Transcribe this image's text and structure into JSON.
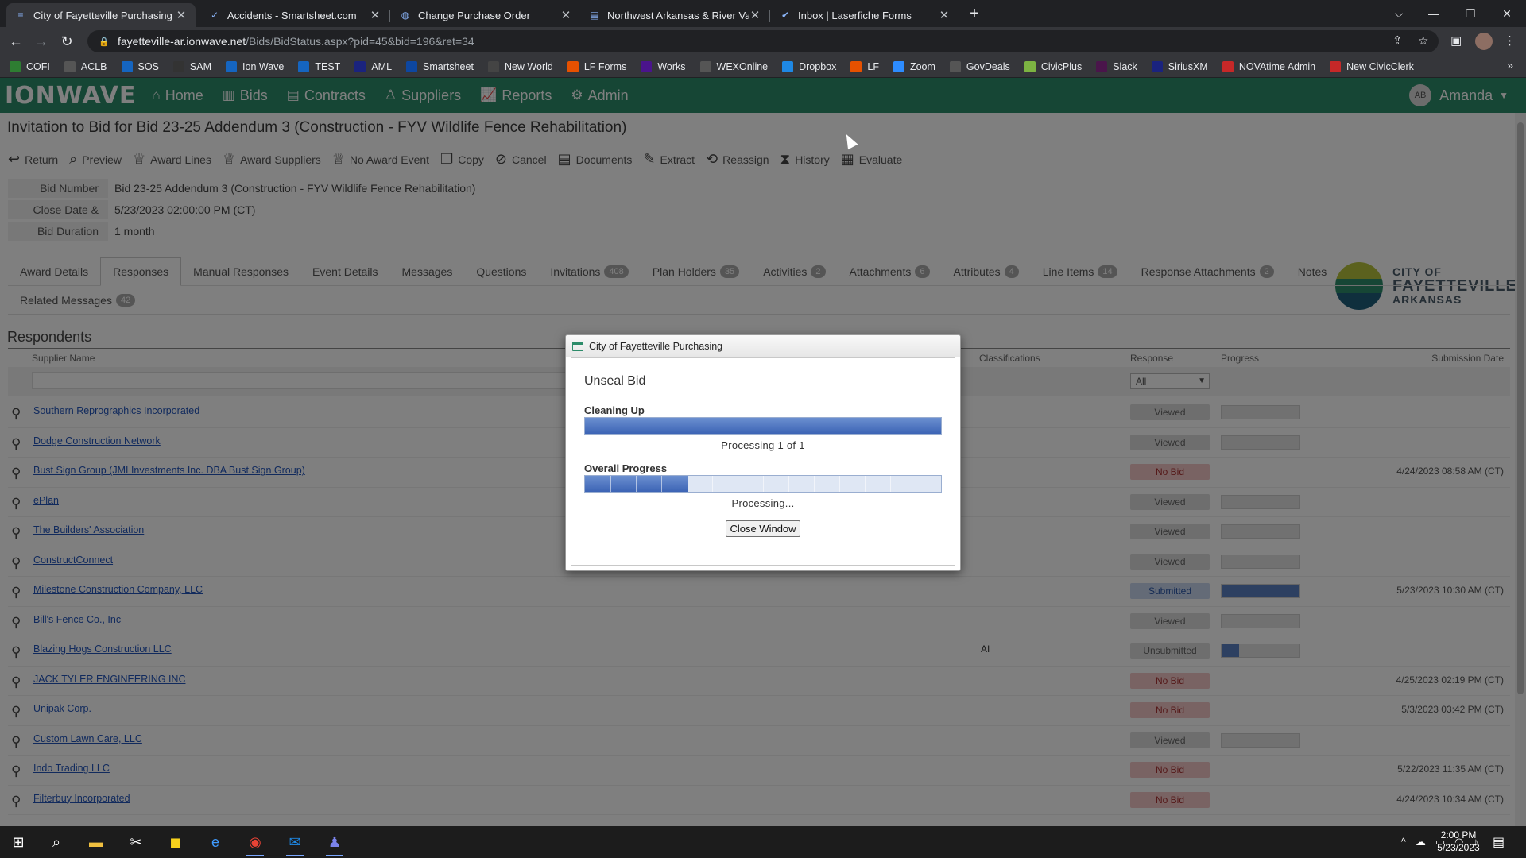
{
  "browser": {
    "tabs": [
      {
        "title": "City of Fayetteville Purchasing",
        "icon": "ionwave-icon",
        "active": true
      },
      {
        "title": "Accidents - Smartsheet.com",
        "icon": "smartsheet-icon",
        "active": false
      },
      {
        "title": "Change Purchase Order",
        "icon": "globe-icon",
        "active": false
      },
      {
        "title": "Northwest Arkansas & River Vall",
        "icon": "doc-icon",
        "active": false
      },
      {
        "title": "Inbox | Laserfiche Forms",
        "icon": "laserfiche-icon",
        "active": false
      }
    ],
    "url_host": "fayetteville-ar.ionwave.net",
    "url_path": "/Bids/BidStatus.aspx?pid=45&bid=196&ret=34",
    "bookmarks": [
      {
        "label": "COFI",
        "color": "#2e7d32"
      },
      {
        "label": "ACLB",
        "color": "#555555"
      },
      {
        "label": "SOS",
        "color": "#1565c0"
      },
      {
        "label": "SAM",
        "color": "#333333"
      },
      {
        "label": "Ion Wave",
        "color": "#1565c0"
      },
      {
        "label": "TEST",
        "color": "#1565c0"
      },
      {
        "label": "AML",
        "color": "#1a237e"
      },
      {
        "label": "Smartsheet",
        "color": "#0d47a1"
      },
      {
        "label": "New World",
        "color": "#444444"
      },
      {
        "label": "LF Forms",
        "color": "#e65100"
      },
      {
        "label": "Works",
        "color": "#4a148c"
      },
      {
        "label": "WEXOnline",
        "color": "#555555"
      },
      {
        "label": "Dropbox",
        "color": "#1e88e5"
      },
      {
        "label": "LF",
        "color": "#e65100"
      },
      {
        "label": "Zoom",
        "color": "#2d8cff"
      },
      {
        "label": "GovDeals",
        "color": "#555555"
      },
      {
        "label": "CivicPlus",
        "color": "#7cb342"
      },
      {
        "label": "Slack",
        "color": "#4a154b"
      },
      {
        "label": "SiriusXM",
        "color": "#1a237e"
      },
      {
        "label": "NOVAtime Admin",
        "color": "#c62828"
      },
      {
        "label": "New CivicClerk",
        "color": "#c62828"
      }
    ]
  },
  "app": {
    "logo": "IONWAVE",
    "nav": [
      {
        "label": "Home",
        "icon": "home-icon"
      },
      {
        "label": "Bids",
        "icon": "bids-icon"
      },
      {
        "label": "Contracts",
        "icon": "contracts-icon"
      },
      {
        "label": "Suppliers",
        "icon": "suppliers-icon"
      },
      {
        "label": "Reports",
        "icon": "reports-icon"
      },
      {
        "label": "Admin",
        "icon": "gear-icon"
      }
    ],
    "user_initials": "AB",
    "user_name": "Amanda",
    "page_title": "Invitation to Bid for Bid 23-25 Addendum 3 (Construction - FYV Wildlife Fence Rehabilitation)",
    "toolbar": [
      "Return",
      "Preview",
      "Award Lines",
      "Award Suppliers",
      "No Award Event",
      "Copy",
      "Cancel",
      "Documents",
      "Extract",
      "Reassign",
      "History",
      "Evaluate"
    ],
    "info": [
      {
        "key": "Bid Number",
        "value": "Bid 23-25 Addendum 3 (Construction - FYV Wildlife Fence Rehabilitation)"
      },
      {
        "key": "Close Date & Time",
        "value": "5/23/2023 02:00:00 PM (CT)"
      },
      {
        "key": "Bid Duration",
        "value": "1 month"
      }
    ],
    "city_logo": {
      "line1": "CITY OF",
      "line2": "FAYETTEVILLE",
      "line3": "ARKANSAS"
    },
    "subtabs_row1": [
      {
        "label": "Award Details",
        "badge": ""
      },
      {
        "label": "Responses",
        "badge": "",
        "active": true
      },
      {
        "label": "Manual Responses",
        "badge": ""
      },
      {
        "label": "Event Details",
        "badge": ""
      },
      {
        "label": "Messages",
        "badge": ""
      },
      {
        "label": "Questions",
        "badge": ""
      },
      {
        "label": "Invitations",
        "badge": "408"
      },
      {
        "label": "Plan Holders",
        "badge": "35"
      },
      {
        "label": "Activities",
        "badge": "2"
      },
      {
        "label": "Attachments",
        "badge": "6"
      },
      {
        "label": "Attributes",
        "badge": "4"
      },
      {
        "label": "Line Items",
        "badge": "14"
      },
      {
        "label": "Response Attachments",
        "badge": "2"
      },
      {
        "label": "Notes",
        "badge": ""
      }
    ],
    "subtabs_row2": [
      {
        "label": "Related Messages",
        "badge": "42"
      }
    ],
    "respondents": {
      "title": "Respondents",
      "headers": {
        "supplier": "Supplier Name",
        "classifications": "Classifications",
        "response": "Response",
        "progress": "Progress",
        "submission": "Submission Date"
      },
      "filter_value": "All",
      "rows": [
        {
          "supplier": "Southern Reprographics Incorporated",
          "cls": "",
          "status": "Viewed",
          "kind": "viewed",
          "progress": 0,
          "show_prog": true,
          "date": ""
        },
        {
          "supplier": "Dodge Construction Network",
          "cls": "",
          "status": "Viewed",
          "kind": "viewed",
          "progress": 0,
          "show_prog": true,
          "date": ""
        },
        {
          "supplier": "Bust Sign Group (JMI Investments Inc. DBA Bust Sign Group)",
          "cls": "",
          "status": "No Bid",
          "kind": "nobid",
          "progress": 0,
          "show_prog": false,
          "date": "4/24/2023 08:58 AM (CT)"
        },
        {
          "supplier": "ePlan",
          "cls": "",
          "status": "Viewed",
          "kind": "viewed",
          "progress": 0,
          "show_prog": true,
          "date": ""
        },
        {
          "supplier": "The Builders' Association",
          "cls": "",
          "status": "Viewed",
          "kind": "viewed",
          "progress": 0,
          "show_prog": true,
          "date": ""
        },
        {
          "supplier": "ConstructConnect",
          "cls": "",
          "status": "Viewed",
          "kind": "viewed",
          "progress": 0,
          "show_prog": true,
          "date": ""
        },
        {
          "supplier": "Milestone Construction Company, LLC",
          "cls": "",
          "status": "Submitted",
          "kind": "submitted",
          "progress": 100,
          "show_prog": true,
          "date": "5/23/2023 10:30 AM (CT)"
        },
        {
          "supplier": "Bill's Fence Co., Inc",
          "cls": "",
          "status": "Viewed",
          "kind": "viewed",
          "progress": 0,
          "show_prog": true,
          "date": ""
        },
        {
          "supplier": "Blazing Hogs Construction LLC",
          "cls": "AI",
          "status": "Unsubmitted",
          "kind": "unsubmitted",
          "progress": 22,
          "show_prog": true,
          "date": ""
        },
        {
          "supplier": "JACK TYLER ENGINEERING INC",
          "cls": "",
          "status": "No Bid",
          "kind": "nobid",
          "progress": 0,
          "show_prog": false,
          "date": "4/25/2023 02:19 PM (CT)"
        },
        {
          "supplier": "Unipak Corp.",
          "cls": "",
          "status": "No Bid",
          "kind": "nobid",
          "progress": 0,
          "show_prog": false,
          "date": "5/3/2023 03:42 PM (CT)"
        },
        {
          "supplier": "Custom Lawn Care, LLC",
          "cls": "",
          "status": "Viewed",
          "kind": "viewed",
          "progress": 0,
          "show_prog": true,
          "date": ""
        },
        {
          "supplier": "Indo Trading LLC",
          "cls": "",
          "status": "No Bid",
          "kind": "nobid",
          "progress": 0,
          "show_prog": false,
          "date": "5/22/2023 11:35 AM (CT)"
        },
        {
          "supplier": "Filterbuy Incorporated",
          "cls": "",
          "status": "No Bid",
          "kind": "nobid",
          "progress": 0,
          "show_prog": false,
          "date": "4/24/2023 10:34 AM (CT)"
        }
      ]
    }
  },
  "dialog": {
    "window_title": "City of Fayetteville Purchasing",
    "heading": "Unseal Bid",
    "step_label": "Cleaning Up",
    "step_progress": 1.0,
    "step_note": "Processing 1 of 1",
    "overall_label": "Overall Progress",
    "overall_progress": 0.29,
    "overall_segments": 14,
    "overall_note": "Processing...",
    "close_label": "Close Window"
  },
  "taskbar": {
    "time": "2:00 PM",
    "date": "5/23/2023"
  }
}
